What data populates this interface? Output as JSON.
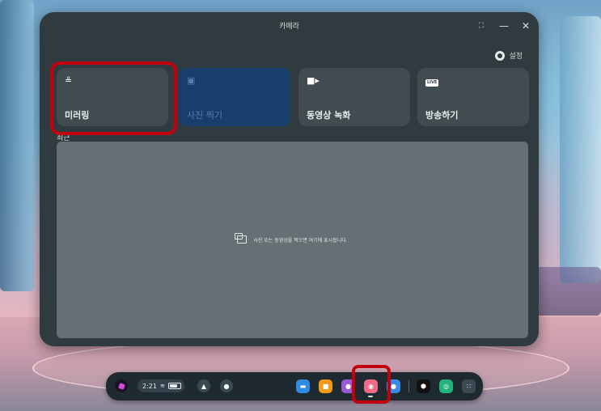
{
  "window": {
    "title": "카메라",
    "settings_label": "설정"
  },
  "cards": [
    {
      "label": "미러링",
      "icon": "cast-icon",
      "selected": true
    },
    {
      "label": "사진 찍기",
      "icon": "camera-photo-icon",
      "disabled": true
    },
    {
      "label": "동영상 녹화",
      "icon": "video-record-icon"
    },
    {
      "label": "방송하기",
      "icon": "live-icon",
      "badge": "LIVE"
    }
  ],
  "gallery": {
    "label": "최근",
    "empty_text": "사진 또는 동영상을 찍으면 여기에 표시됩니다."
  },
  "taskbar": {
    "time": "2:21",
    "apps": [
      {
        "name": "notifications-icon",
        "color": "#3b4a52"
      },
      {
        "name": "controller-icon",
        "color": "#3b4a52"
      },
      {
        "name": "browser-app-icon",
        "color": "#2f8ce0"
      },
      {
        "name": "store-app-icon",
        "color": "#f39a19"
      },
      {
        "name": "people-app-icon",
        "color": "#9a5bd6"
      },
      {
        "name": "camera-app-icon",
        "color": "#f06a86"
      },
      {
        "name": "horizon-app-icon",
        "color": "#3a8be6"
      },
      {
        "name": "meta-app-icon",
        "color": "#111111"
      },
      {
        "name": "explore-app-icon",
        "color": "#21b37a"
      },
      {
        "name": "app-library-icon",
        "color": "#3b4a52"
      }
    ]
  },
  "colors": {
    "highlight": "#c4000e",
    "window_bg": "#2f3b3f",
    "disabled_card": "#173e6d"
  }
}
